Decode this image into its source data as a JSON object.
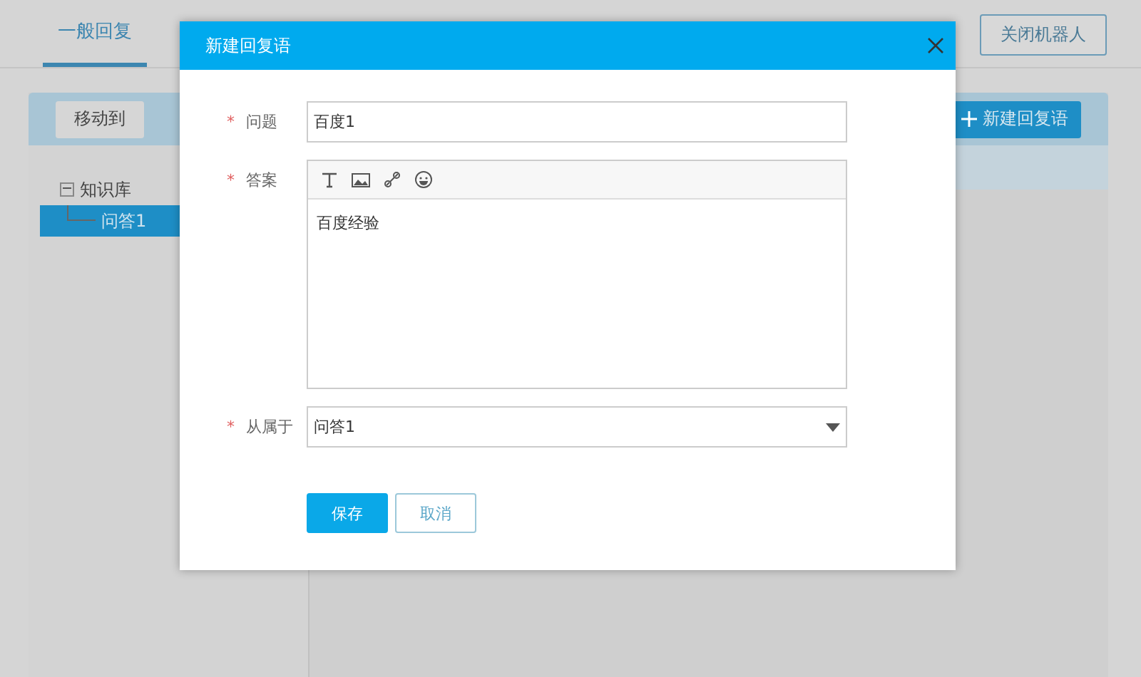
{
  "tabs": [
    {
      "label": "一般回复",
      "selected": true
    }
  ],
  "close_robot_button": "关闭机器人",
  "toolbar": {
    "buttons": [
      "移动到"
    ],
    "new_button": "新建回复语"
  },
  "tree": [
    {
      "label": "知识库",
      "expanded": true,
      "selected": false,
      "children": [
        {
          "label": "问答1",
          "selected": true
        }
      ]
    }
  ],
  "dialog": {
    "title": "新建回复语",
    "fields": [
      {
        "kind": "input",
        "required_mark": "*",
        "label": "问题",
        "value": "百度1"
      },
      {
        "kind": "editor",
        "required_mark": "*",
        "label": "答案",
        "value": "百度经验"
      },
      {
        "kind": "select",
        "required_mark": "*",
        "label": "从属于",
        "value": "问答1"
      }
    ],
    "buttons": [
      {
        "label": "保存",
        "primary": true
      },
      {
        "label": "取消",
        "primary": false
      }
    ]
  }
}
